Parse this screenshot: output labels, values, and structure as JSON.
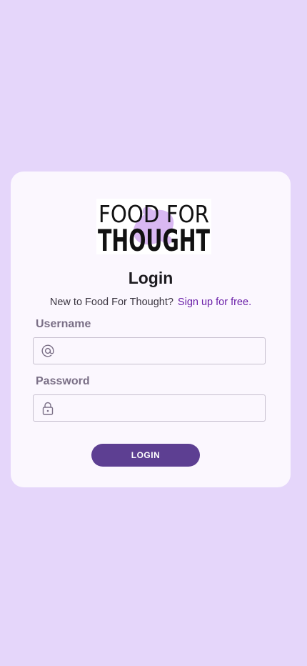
{
  "app": {
    "logo_text_line1": "FOOD FOR",
    "logo_text_line2": "THOUGHT"
  },
  "login": {
    "title": "Login",
    "signup_prompt": "New to Food For Thought?",
    "signup_link": "Sign up for free.",
    "username_label": "Username",
    "username_value": "",
    "password_label": "Password",
    "password_value": "",
    "submit_label": "LOGIN"
  },
  "icons": {
    "username": "at-icon",
    "password": "lock-icon"
  },
  "colors": {
    "background": "#e5d6fa",
    "card": "#fbf7fe",
    "accent": "#5d3f92",
    "link": "#6a1fa8",
    "label": "#7a6f86"
  }
}
